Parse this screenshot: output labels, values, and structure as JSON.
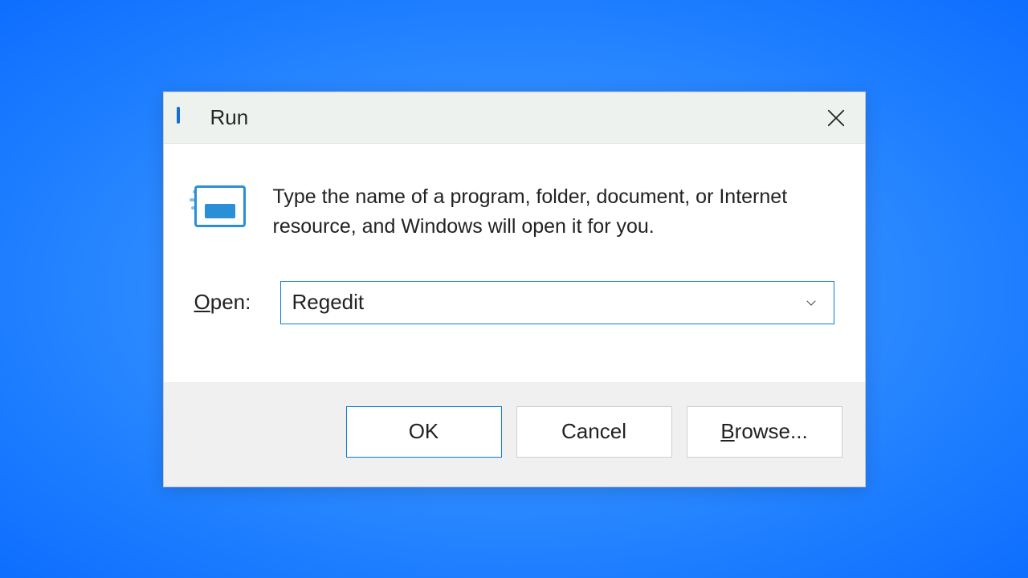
{
  "dialog": {
    "title": "Run",
    "description": "Type the name of a program, folder, document, or Internet resource, and Windows will open it for you.",
    "open_label_prefix": "O",
    "open_label_rest": "pen:",
    "input_value": "Regedit",
    "buttons": {
      "ok": "OK",
      "cancel": "Cancel",
      "browse_prefix": "B",
      "browse_rest": "rowse..."
    }
  }
}
